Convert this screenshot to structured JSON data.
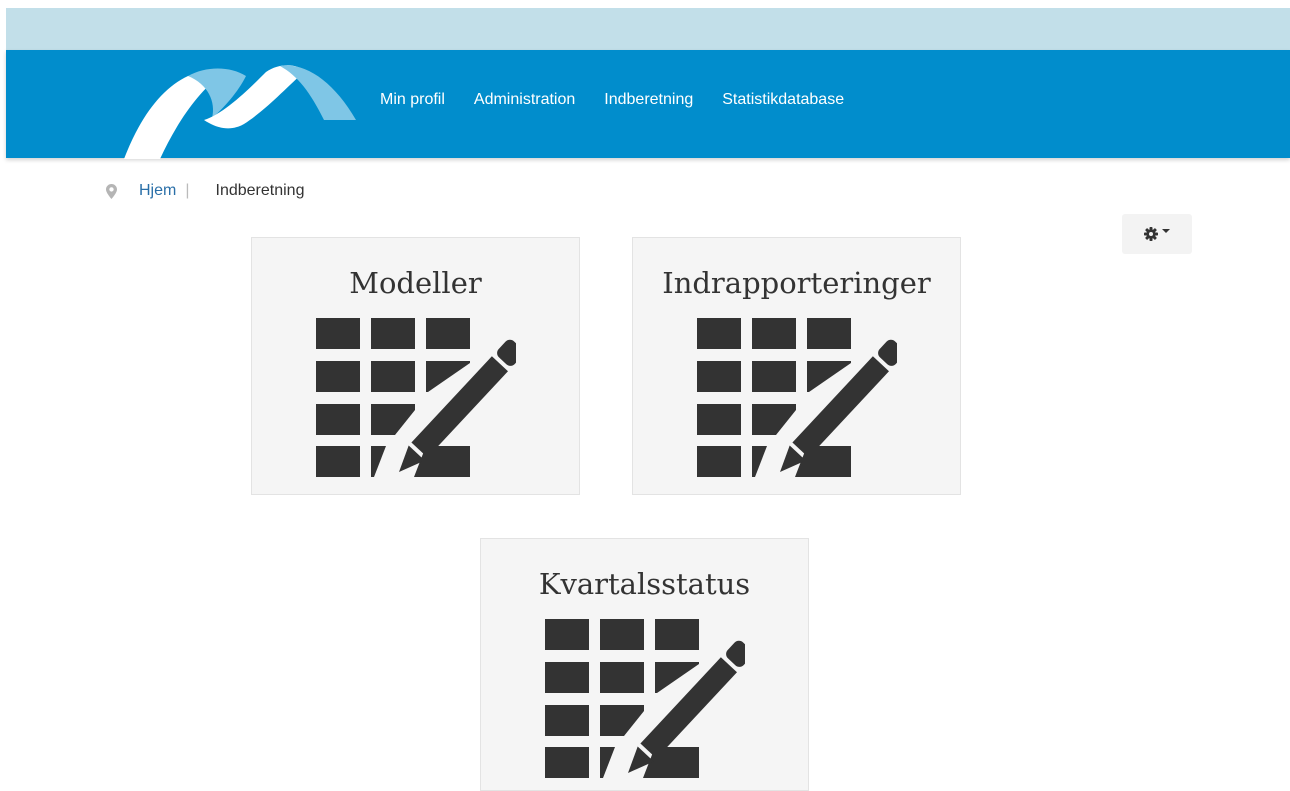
{
  "nav": {
    "logo": "brand-logo",
    "links": [
      "Min profil",
      "Administration",
      "Indberetning",
      "Statistikdatabase"
    ]
  },
  "breadcrumb": {
    "icon": "map-pin-icon",
    "home": "Hjem",
    "separator": "|",
    "current": "Indberetning"
  },
  "settings": {
    "icon": "gear-icon",
    "caret": "caret-down-icon"
  },
  "tiles": [
    {
      "title": "Modeller",
      "icon": "table-edit-icon"
    },
    {
      "title": "Indrapporteringer",
      "icon": "table-edit-icon"
    },
    {
      "title": "Kvartalsstatus",
      "icon": "table-edit-icon"
    }
  ],
  "colors": {
    "top_strip": "#c2dfe9",
    "navbar": "#018dcc",
    "logo_light": "#7fc6e6",
    "tile_bg": "#f5f5f5",
    "icon": "#333333",
    "link": "#2a6fa8"
  }
}
